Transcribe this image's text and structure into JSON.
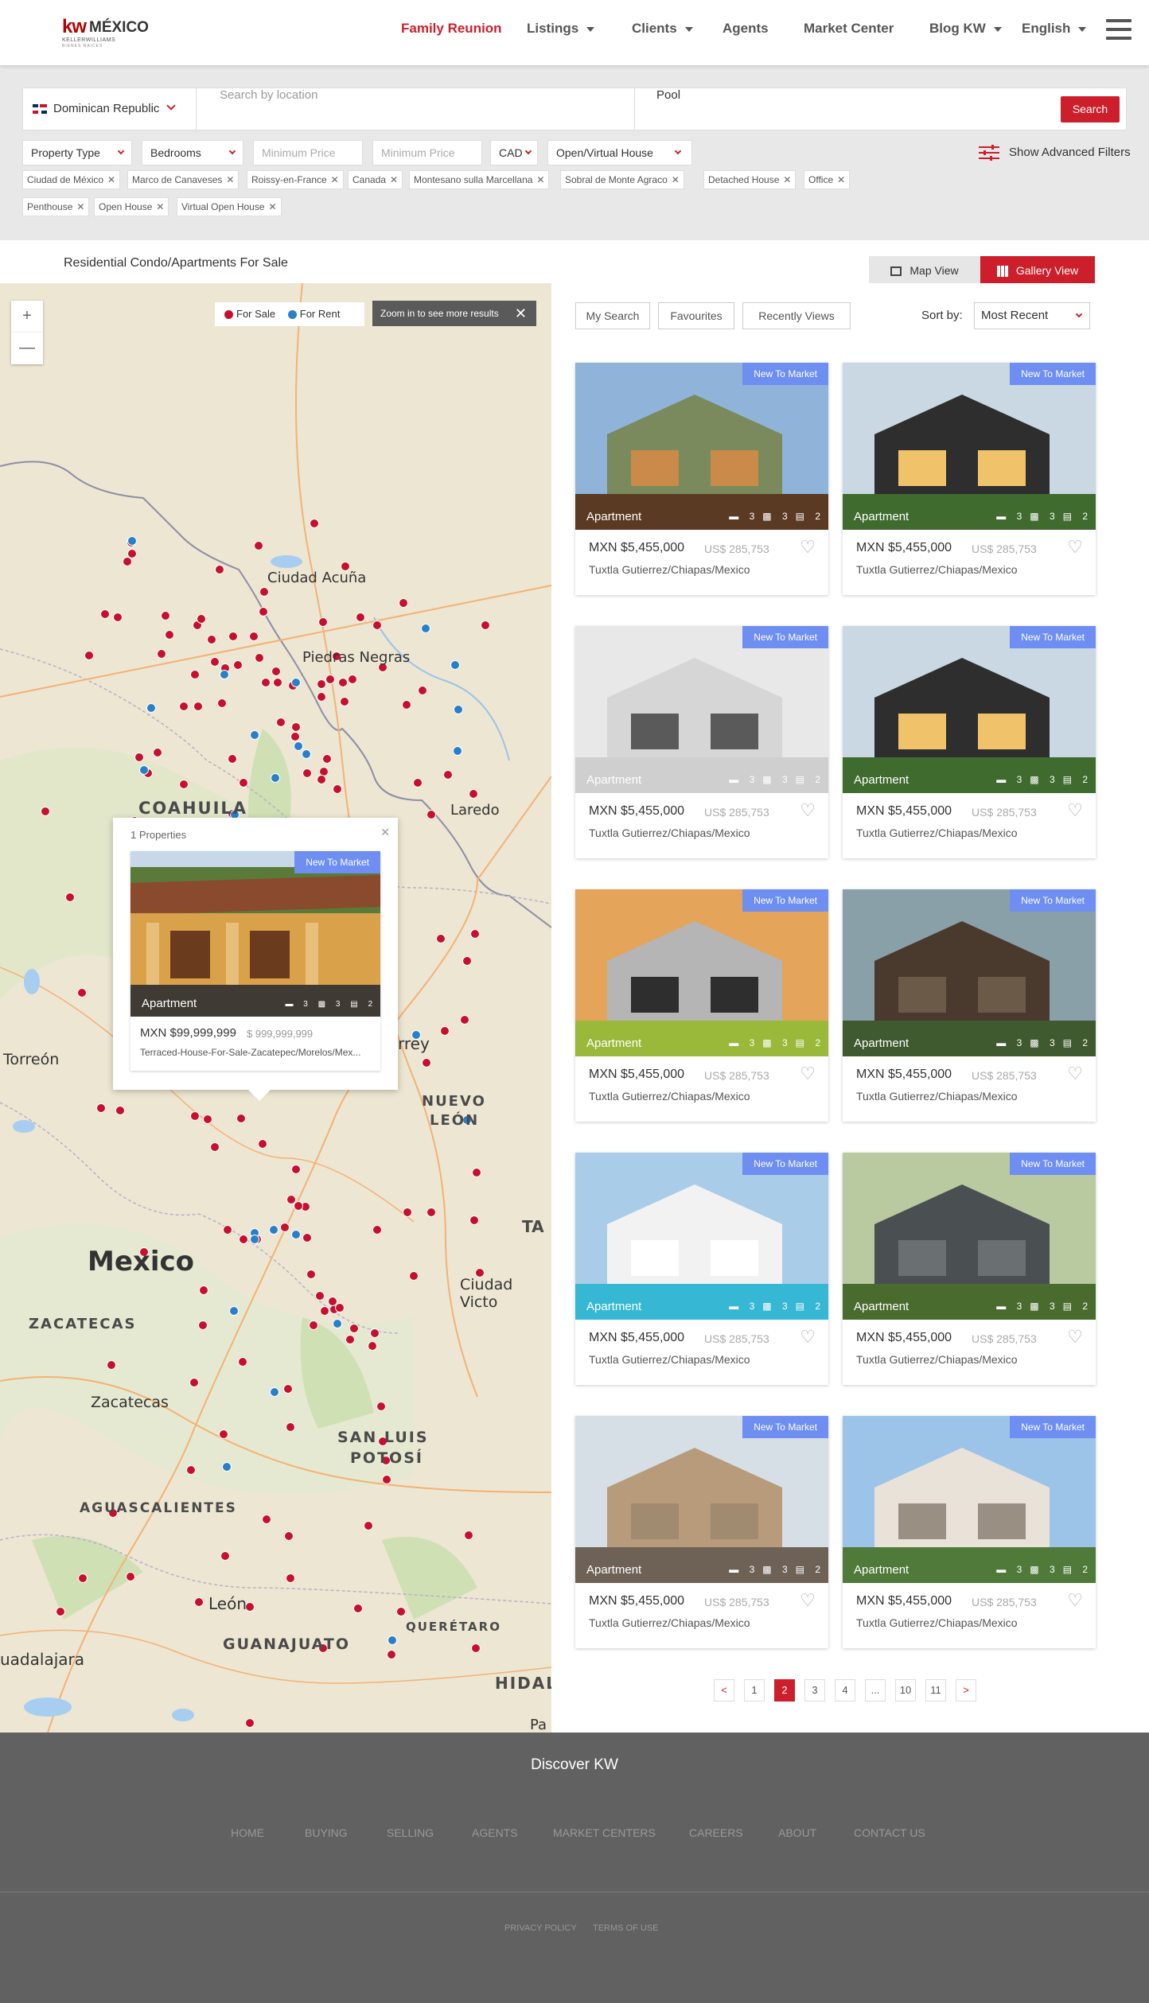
{
  "header": {
    "logo": {
      "kw": "kw",
      "brand": "MÉXICO",
      "sub": "KELLERWILLIAMS",
      "sub2": "BIENES RAICES"
    },
    "nav": [
      {
        "label": "Family Reunion",
        "active": true
      },
      {
        "label": "Listings",
        "dropdown": true
      },
      {
        "label": "Clients",
        "dropdown": true
      },
      {
        "label": "Agents"
      },
      {
        "label": "Market Center"
      },
      {
        "label": "Blog KW",
        "dropdown": true
      },
      {
        "label": "English",
        "dropdown": true
      }
    ],
    "menu_icon": "hamburger-icon"
  },
  "search": {
    "country": "Dominican Republic",
    "location_placeholder": "Search by location",
    "keyword_value": "Pool",
    "button": "Search"
  },
  "filters": {
    "property_type": "Property Type",
    "bedrooms": "Bedrooms",
    "min_price_1": "Minimum Price",
    "min_price_2": "Minimum Price",
    "currency": "CAD",
    "open_house": "Open/Virtual House",
    "advanced": "Show Advanced Filters",
    "chips": [
      "Ciudad de México",
      "Marco de Canaveses",
      "Roissy-en-France",
      "Canada",
      "Montesano sulla Marcellana",
      "Sobral de Monte Agraco",
      "Detached House",
      "Office",
      "Penthouse",
      "Open House",
      "Virtual Open House"
    ]
  },
  "results": {
    "title": "Residential Condo/Apartments For Sale",
    "map_view": "Map View",
    "gallery_view": "Gallery View"
  },
  "map": {
    "legend_sale": "For Sale",
    "legend_rent": "For Rent",
    "zoom_tip": "Zoom in to see more results",
    "sale_color": "#c8102e",
    "rent_color": "#2a7fc9",
    "labels": {
      "coahuila": "COAHUILA",
      "acuna": "Ciudad Acuña",
      "negras": "Piedras Negras",
      "laredo": "Laredo",
      "torreon": "Torreón",
      "monterrey": "rrey",
      "nuevo1": "NUEVO",
      "nuevo2": "LEÓN",
      "ta": "TA",
      "mexico": "Mexico",
      "victoria": "Ciudad Victo",
      "zacatecas_state": "ZACATECAS",
      "zacatecas": "Zacatecas",
      "slp1": "SAN LUIS",
      "slp2": "POTOSÍ",
      "ags": "AGUASCALIENTES",
      "leon": "León",
      "guanajuato": "GUANAJUATO",
      "queretaro": "QUERÉTARO",
      "guadalajara": "uadalajara",
      "hidal": "HIDAL",
      "pa": "Pa"
    },
    "popup": {
      "count": "1 Properties",
      "badge": "New To Market",
      "type": "Apartment",
      "beds": "3",
      "baths": "3",
      "parking": "2",
      "price": "MXN $99,999,999",
      "usd": "$ 999,999,999",
      "address": "Terraced-House-For-Sale-Zacatepec/Morelos/Mex..."
    }
  },
  "toolbar": {
    "tabs": [
      "My Search",
      "Favourites",
      "Recently Views"
    ],
    "sort_label": "Sort by:",
    "sort_value": "Most Recent"
  },
  "listings": [
    {
      "badge": "New To Market",
      "type": "Apartment",
      "beds": "3",
      "baths": "3",
      "parking": "2",
      "price": "MXN $5,455,000",
      "usd": "US$ 285,753",
      "address": "Tuxtla Gutierrez/Chiapas/Mexico"
    },
    {
      "badge": "New To Market",
      "type": "Apartment",
      "beds": "3",
      "baths": "3",
      "parking": "2",
      "price": "MXN $5,455,000",
      "usd": "US$ 285,753",
      "address": "Tuxtla Gutierrez/Chiapas/Mexico"
    },
    {
      "badge": "New To Market",
      "type": "Apartment",
      "beds": "3",
      "baths": "3",
      "parking": "2",
      "price": "MXN $5,455,000",
      "usd": "US$ 285,753",
      "address": "Tuxtla Gutierrez/Chiapas/Mexico"
    },
    {
      "badge": "New To Market",
      "type": "Apartment",
      "beds": "3",
      "baths": "3",
      "parking": "2",
      "price": "MXN $5,455,000",
      "usd": "US$ 285,753",
      "address": "Tuxtla Gutierrez/Chiapas/Mexico"
    },
    {
      "badge": "New To Market",
      "type": "Apartment",
      "beds": "3",
      "baths": "3",
      "parking": "2",
      "price": "MXN $5,455,000",
      "usd": "US$ 285,753",
      "address": "Tuxtla Gutierrez/Chiapas/Mexico"
    },
    {
      "badge": "New To Market",
      "type": "Apartment",
      "beds": "3",
      "baths": "3",
      "parking": "2",
      "price": "MXN $5,455,000",
      "usd": "US$ 285,753",
      "address": "Tuxtla Gutierrez/Chiapas/Mexico"
    },
    {
      "badge": "New To Market",
      "type": "Apartment",
      "beds": "3",
      "baths": "3",
      "parking": "2",
      "price": "MXN $5,455,000",
      "usd": "US$ 285,753",
      "address": "Tuxtla Gutierrez/Chiapas/Mexico"
    },
    {
      "badge": "New To Market",
      "type": "Apartment",
      "beds": "3",
      "baths": "3",
      "parking": "2",
      "price": "MXN $5,455,000",
      "usd": "US$ 285,753",
      "address": "Tuxtla Gutierrez/Chiapas/Mexico"
    },
    {
      "badge": "New To Market",
      "type": "Apartment",
      "beds": "3",
      "baths": "3",
      "parking": "2",
      "price": "MXN $5,455,000",
      "usd": "US$ 285,753",
      "address": "Tuxtla Gutierrez/Chiapas/Mexico"
    },
    {
      "badge": "New To Market",
      "type": "Apartment",
      "beds": "3",
      "baths": "3",
      "parking": "2",
      "price": "MXN $5,455,000",
      "usd": "US$ 285,753",
      "address": "Tuxtla Gutierrez/Chiapas/Mexico"
    }
  ],
  "pagination": [
    "<",
    "1",
    "2",
    "3",
    "4",
    "...",
    "10",
    "11",
    ">"
  ],
  "current_page": "2",
  "footer": {
    "discover": "Discover KW",
    "links": [
      "HOME",
      "BUYING",
      "SELLING",
      "AGENTS",
      "MARKET CENTERS",
      "CAREERS",
      "ABOUT",
      "CONTACT US"
    ],
    "legal": [
      "PRIVACY POLICY",
      "TERMS OF USE"
    ]
  }
}
